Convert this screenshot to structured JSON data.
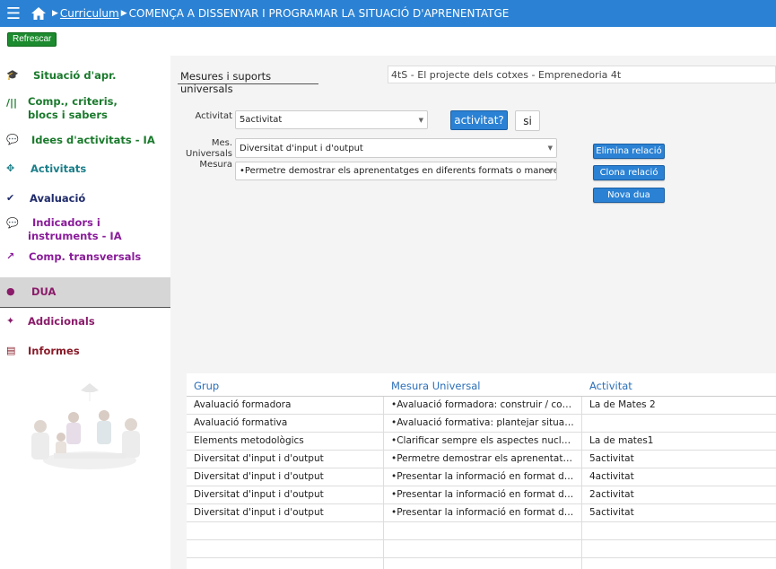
{
  "header": {
    "breadcrumb_link": "Curriculum",
    "breadcrumb_current": "COMENÇA A DISSENYAR I PROGRAMAR LA SITUACIÓ D'APRENENTATGE"
  },
  "refresh_label": "Refrescar",
  "sidebar": {
    "items": [
      {
        "label_1": "Situació d'apr.",
        "label_2": ""
      },
      {
        "label_1": "Comp., criteris,",
        "label_2": "blocs i sabers"
      },
      {
        "label_1": "Idees d'activitats - IA",
        "label_2": ""
      },
      {
        "label_1": "Activitats",
        "label_2": ""
      },
      {
        "label_1": "Avaluació",
        "label_2": ""
      },
      {
        "label_1": "Indicadors i",
        "label_2": "instruments - IA"
      },
      {
        "label_1": "Comp. transversals",
        "label_2": ""
      },
      {
        "label_1": "DUA",
        "label_2": ""
      },
      {
        "label_1": "Addicionals",
        "label_2": ""
      },
      {
        "label_1": "Informes",
        "label_2": ""
      }
    ]
  },
  "tab_label": "Mesures i suports universals",
  "project_title": "4tS - El projecte dels cotxes - Emprenedoria 4t",
  "form": {
    "activitat_label": "Activitat",
    "activitat_value": "5activitat",
    "activitat_button": "activitat?",
    "si_button": "si",
    "mes_label_1": "Mes.",
    "mes_label_2": "Universals",
    "mes_value": "Diversitat d'input i d'output",
    "mesura_label": "Mesura",
    "mesura_value": "•Permetre demostrar els aprenentatges en diferents formats o maneres (..."
  },
  "actions": {
    "elimina": "Elimina relació",
    "clona": "Clona relació",
    "nova": "Nova dua"
  },
  "table": {
    "headers": [
      "Grup",
      "Mesura Universal",
      "Activitat"
    ],
    "rows": [
      [
        "Avaluació formadora",
        "•Avaluació formadora: construir / comp...",
        "La de Mates 2"
      ],
      [
        "Avaluació formativa",
        "•Avaluació formativa: plantejar situacio...",
        ""
      ],
      [
        "Elements metodològics",
        "•Clarificar sempre els aspectes nuclears...",
        "La de mates1"
      ],
      [
        "Diversitat d'input i d'output",
        "•Permetre demostrar els aprenentatges...",
        "5activitat"
      ],
      [
        "Diversitat d'input i d'output",
        "•Presentar la informació en format digit...",
        "4activitat"
      ],
      [
        "Diversitat d'input i d'output",
        "•Presentar la informació en format digit...",
        "2activitat"
      ],
      [
        "Diversitat d'input i d'output",
        "•Presentar la informació en format digit...",
        "5activitat"
      ],
      [
        "",
        "",
        ""
      ],
      [
        "",
        "",
        ""
      ],
      [
        "",
        "",
        ""
      ]
    ]
  }
}
